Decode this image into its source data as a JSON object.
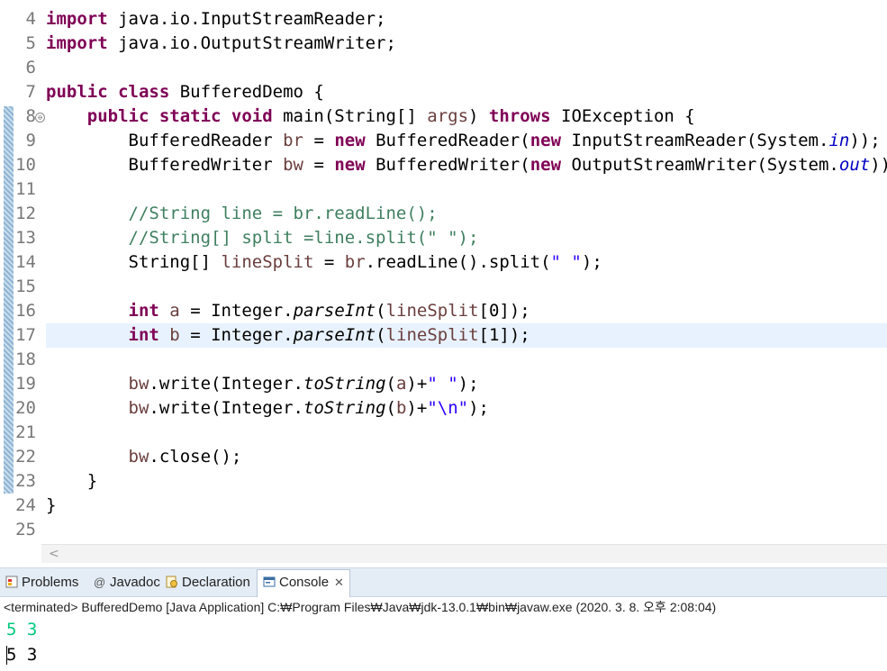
{
  "editor": {
    "line_numbers": [
      "4",
      "5",
      "6",
      "7",
      "8",
      "9",
      "10",
      "11",
      "12",
      "13",
      "14",
      "15",
      "16",
      "17",
      "18",
      "19",
      "20",
      "21",
      "22",
      "23",
      "24",
      "25"
    ],
    "lines": {
      "l4_a": "import",
      "l4_b": " java.io.InputStreamReader;",
      "l5_a": "import",
      "l5_b": " java.io.OutputStreamWriter;",
      "l7_a": "public class",
      "l7_b": " BufferedDemo {",
      "l8_a": "    public static void",
      "l8_b": " main(String[] ",
      "l8_c": "args",
      "l8_d": ") ",
      "l8_e": "throws",
      "l8_f": " IOException {",
      "l9_a": "        BufferedReader ",
      "l9_b": "br",
      "l9_c": " = ",
      "l9_d": "new",
      "l9_e": " BufferedReader(",
      "l9_f": "new",
      "l9_g": " InputStreamReader(System.",
      "l9_h": "in",
      "l9_i": "));",
      "l10_a": "        BufferedWriter ",
      "l10_b": "bw",
      "l10_c": " = ",
      "l10_d": "new",
      "l10_e": " BufferedWriter(",
      "l10_f": "new",
      "l10_g": " OutputStreamWriter(System.",
      "l10_h": "out",
      "l10_i": "));",
      "l12": "        //String line = br.readLine();",
      "l13": "        //String[] split =line.split(\" \");",
      "l14_a": "        String[] ",
      "l14_b": "lineSplit",
      "l14_c": " = ",
      "l14_d": "br",
      "l14_e": ".readLine().split(",
      "l14_f": "\" \"",
      "l14_g": ");",
      "l16_a": "        ",
      "l16_b": "int",
      "l16_c": " ",
      "l16_d": "a",
      "l16_e": " = Integer.",
      "l16_f": "parseInt",
      "l16_g": "(",
      "l16_h": "lineSplit",
      "l16_i": "[0]);",
      "l17_a": "        ",
      "l17_b": "int",
      "l17_c": " ",
      "l17_d": "b",
      "l17_e": " = Integer.",
      "l17_f": "parseInt",
      "l17_g": "(",
      "l17_h": "lineSplit",
      "l17_i": "[1]);",
      "l19_a": "        ",
      "l19_b": "bw",
      "l19_c": ".write(Integer.",
      "l19_d": "toString",
      "l19_e": "(",
      "l19_f": "a",
      "l19_g": ")+",
      "l19_h": "\" \"",
      "l19_i": ");",
      "l20_a": "        ",
      "l20_b": "bw",
      "l20_c": ".write(Integer.",
      "l20_d": "toString",
      "l20_e": "(",
      "l20_f": "b",
      "l20_g": ")+",
      "l20_h": "\"\\n\"",
      "l20_i": ");",
      "l22_a": "        ",
      "l22_b": "bw",
      "l22_c": ".close();",
      "l23": "    }",
      "l24": "}"
    },
    "fold_marker": "⊖",
    "scroll_left_arrow": "<"
  },
  "panel": {
    "tabs": [
      {
        "label": "Problems",
        "icon": "problems-icon"
      },
      {
        "label": "Javadoc",
        "icon": "at-icon"
      },
      {
        "label": "Declaration",
        "icon": "declaration-icon"
      },
      {
        "label": "Console",
        "icon": "console-icon",
        "active": true
      }
    ],
    "at_glyph": "@",
    "close_glyph": "✕",
    "status": "<terminated> BufferedDemo [Java Application] C:₩Program Files₩Java₩jdk-13.0.1₩bin₩javaw.exe (2020. 3. 8. 오후 2:08:04)",
    "output_input": "5 3",
    "output_result": "5 3"
  },
  "colors": {
    "keyword": "#7f0055",
    "comment": "#3f7f5f",
    "string": "#2a00ff",
    "field": "#0000c0",
    "console_input": "#00c87d",
    "current_line": "#e8f2fe"
  }
}
